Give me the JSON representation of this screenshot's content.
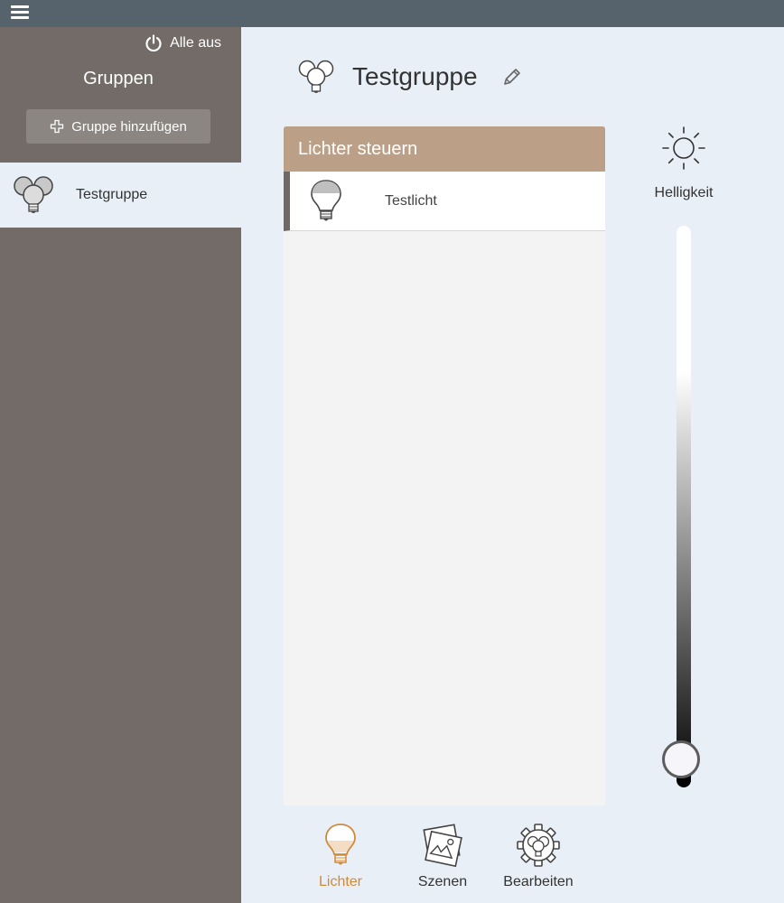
{
  "topbar": {
    "menu_icon": "hamburger-icon"
  },
  "sidebar": {
    "all_off_label": "Alle aus",
    "title": "Gruppen",
    "add_group_label": "Gruppe hinzufügen",
    "groups": [
      {
        "label": "Testgruppe",
        "selected": true
      }
    ]
  },
  "main": {
    "title": "Testgruppe",
    "panel": {
      "header": "Lichter steuern",
      "lights": [
        {
          "label": "Testlicht"
        }
      ]
    },
    "brightness": {
      "label": "Helligkeit",
      "level": 0.05
    }
  },
  "tabs": [
    {
      "label": "Lichter",
      "icon": "bulb-icon",
      "active": true
    },
    {
      "label": "Szenen",
      "icon": "scenes-icon",
      "active": false
    },
    {
      "label": "Bearbeiten",
      "icon": "gear-icon",
      "active": false
    }
  ],
  "colors": {
    "topbar": "#56636d",
    "sidebar": "#726b68",
    "panel_header": "#bb9f86",
    "active_tab": "#d18a3a"
  }
}
